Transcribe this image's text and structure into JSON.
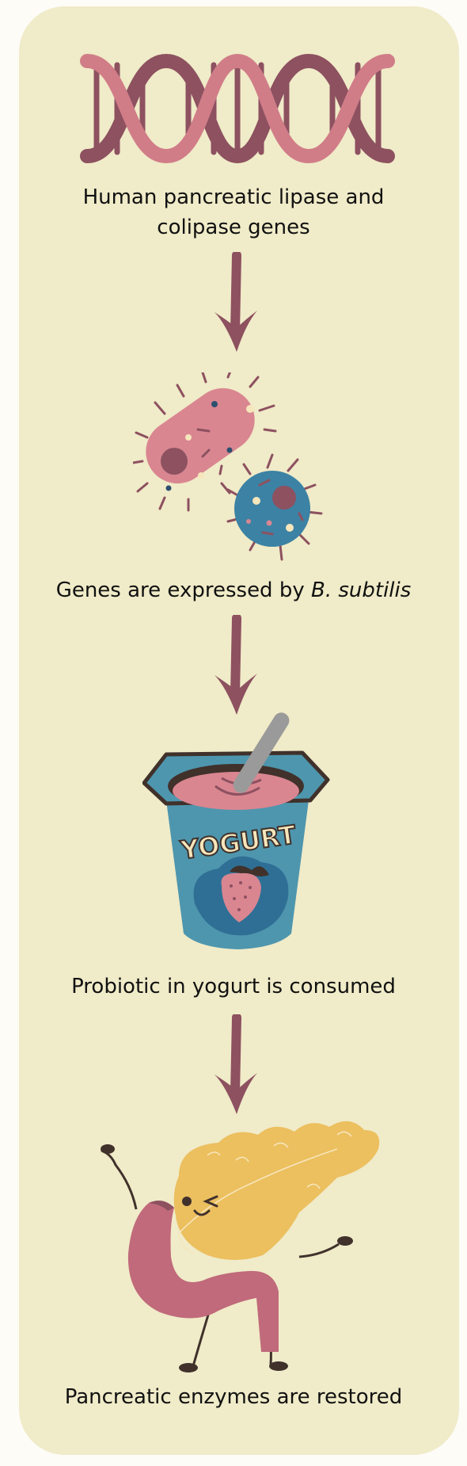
{
  "steps": [
    {
      "label": "Human pancreatic lipase and",
      "label2": "colipase genes",
      "icon": "dna-helix-icon"
    },
    {
      "label": "Genes are expressed by ",
      "label_italic": "B. subtilis",
      "icon": "bacteria-icon"
    },
    {
      "label": "Probiotic in yogurt is consumed",
      "icon": "yogurt-cup-icon",
      "cup_text": "YOGURT"
    },
    {
      "label": "Pancreatic enzymes are restored",
      "icon": "pancreas-character-icon"
    }
  ],
  "colors": {
    "card": "#f0ebc8",
    "arrow": "#8d5160",
    "dna_back": "#8d5160",
    "dna_front": "#d07d88",
    "bacteria_pink": "#d98691",
    "bacteria_blue": "#3c82a4",
    "yogurt_blue": "#4e96ae",
    "pancreas_yellow": "#ecbf5f",
    "pancreas_pink": "#c06a7b"
  }
}
